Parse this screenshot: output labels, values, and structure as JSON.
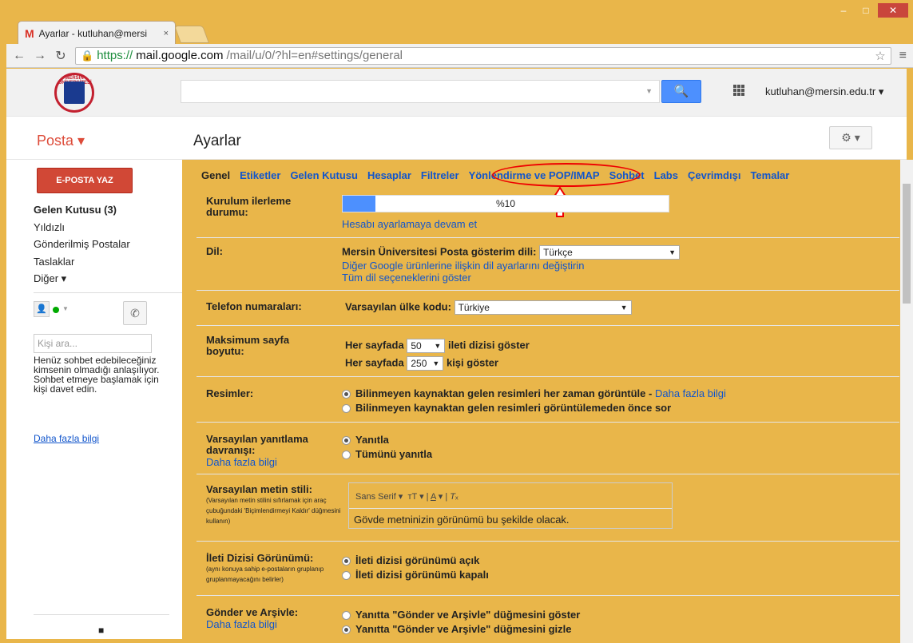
{
  "browser": {
    "tab_title": "Ayarlar - kutluhan@mersi",
    "tab_close": "×",
    "url_https": "https://",
    "url_host": "mail.google.com",
    "url_path": "/mail/u/0/?hl=en#settings/general"
  },
  "header": {
    "user": "kutluhan@mersin.edu.tr",
    "logo_text": "MERSİN ÜNİVERSİTESİ 1992"
  },
  "subheader": {
    "app_menu": "Posta",
    "title": "Ayarlar"
  },
  "nav": {
    "compose": "E-POSTA YAZ",
    "items": [
      {
        "label": "Gelen Kutusu (3)",
        "bold": true
      },
      {
        "label": "Yıldızlı"
      },
      {
        "label": "Gönderilmiş Postalar"
      },
      {
        "label": "Taslaklar"
      },
      {
        "label": "Diğer ▾"
      }
    ],
    "search_placeholder": "Kişi ara...",
    "hint": "Henüz sohbet edebileceğiniz kimsenin olmadığı anlaşılıyor. Sohbet etmeye başlamak için kişi davet edin.",
    "hint_link": "Daha fazla bilgi"
  },
  "tabs": [
    "Genel",
    "Etiketler",
    "Gelen Kutusu",
    "Hesaplar",
    "Filtreler",
    "Yönlendirme ve POP/IMAP",
    "Sohbet",
    "Labs",
    "Çevrimdışı",
    "Temalar"
  ],
  "settings": {
    "setup": {
      "label": "Kurulum ilerleme durumu:",
      "progress": 0.1,
      "progress_text": "%10",
      "link": "Hesabı ayarlamaya devam et"
    },
    "lang": {
      "label": "Dil:",
      "text": "Mersin Üniversitesi Posta gösterim dili:",
      "value": "Türkçe",
      "link1": "Diğer Google ürünlerine ilişkin dil ayarlarını değiştirin",
      "link2": "Tüm dil seçeneklerini göster"
    },
    "phone": {
      "label": "Telefon numaraları:",
      "text": "Varsayılan ülke kodu:",
      "value": "Türkiye"
    },
    "pagesize": {
      "label": "Maksimum sayfa boyutu:",
      "prefix": "Her sayfada",
      "v1": "50",
      "s1": "ileti dizisi göster",
      "v2": "250",
      "s2": "kişi göster"
    },
    "images": {
      "label": "Resimler:",
      "opt1": "Bilinmeyen kaynaktan gelen resimleri her zaman görüntüle",
      "opt1_link": "Daha fazla bilgi",
      "opt2": "Bilinmeyen kaynaktan gelen resimleri görüntülemeden önce sor"
    },
    "reply": {
      "label": "Varsayılan yanıtlama davranışı:",
      "link": "Daha fazla bilgi",
      "opt1": "Yanıtla",
      "opt2": "Tümünü yanıtla"
    },
    "textstyle": {
      "label": "Varsayılan metin stili:",
      "sub": "(Varsayılan metin stilini sıfırlamak için araç çubuğundaki 'Biçimlendirmeyi Kaldır' düğmesini kullanın)",
      "font": "Sans Serif",
      "preview": "Gövde metninizin görünümü bu şekilde olacak."
    },
    "thread": {
      "label": "İleti Dizisi Görünümü:",
      "sub": "(aynı konuya sahip e-postaların gruplanıp gruplanmayacağını belirler)",
      "opt1": "İleti dizisi görünümü açık",
      "opt2": "İleti dizisi görünümü kapalı"
    },
    "archive": {
      "label": "Gönder ve Arşivle:",
      "link": "Daha fazla bilgi",
      "opt1": "Yanıtta \"Gönder ve Arşivle\" düğmesini göster",
      "opt2": "Yanıtta \"Gönder ve Arşivle\" düğmesini gizle"
    }
  },
  "colors": {
    "accent": "#15c",
    "compose": "#d14836",
    "annotation": "#e00"
  }
}
